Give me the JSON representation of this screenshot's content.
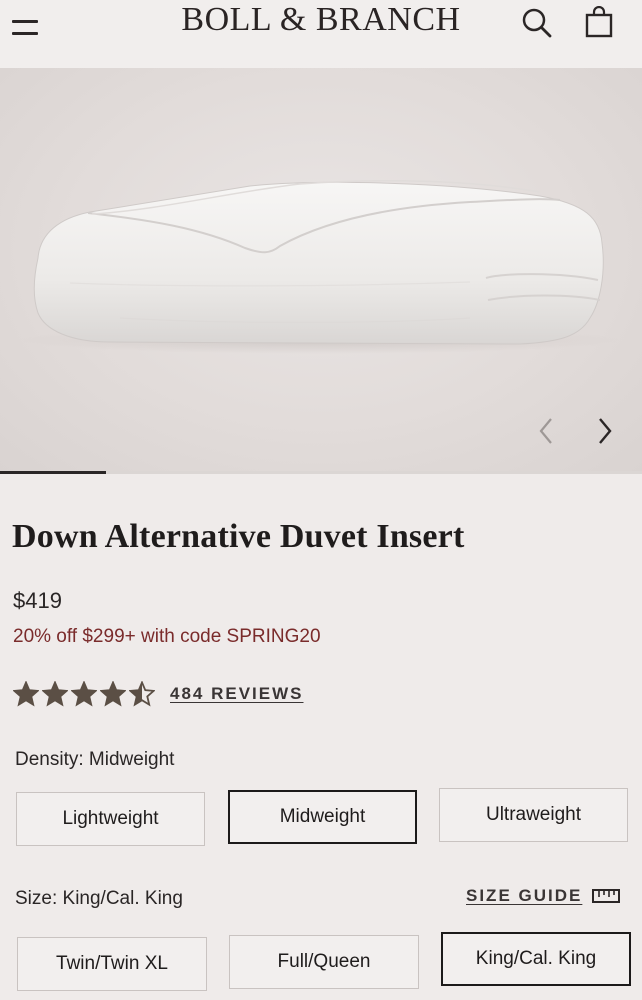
{
  "header": {
    "brand": "BOLL & BRANCH"
  },
  "gallery": {
    "progress_fraction": 0.165
  },
  "product": {
    "title": "Down Alternative Duvet Insert",
    "price": "$419",
    "promo": "20% off $299+ with code SPRING20",
    "rating_stars": 4.5,
    "reviews_label": "484 REVIEWS"
  },
  "density": {
    "label": "Density:",
    "selected": "Midweight",
    "options": [
      "Lightweight",
      "Midweight",
      "Ultraweight"
    ]
  },
  "size": {
    "label": "Size:",
    "selected": "King/Cal. King",
    "guide_label": "SIZE GUIDE",
    "options": [
      "Twin/Twin XL",
      "Full/Queen",
      "King/Cal. King"
    ]
  },
  "colors": {
    "promo": "#7a2b2b",
    "star": "#5b4f45",
    "text": "#2a2626"
  },
  "icons": {
    "menu": "hamburger-menu-icon",
    "search": "search-icon",
    "bag": "shopping-bag-icon",
    "prev": "chevron-left-icon",
    "next": "chevron-right-icon",
    "ruler": "ruler-icon",
    "star": "star-icon"
  }
}
